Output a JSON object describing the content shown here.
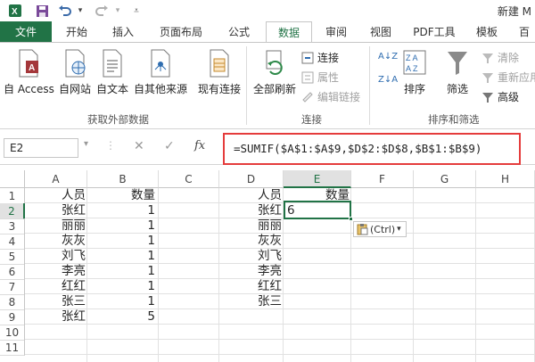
{
  "titlebar": {
    "title": "新建 M"
  },
  "tabs": [
    "文件",
    "开始",
    "插入",
    "页面布局",
    "公式",
    "数据",
    "审阅",
    "视图",
    "PDF工具",
    "模板",
    "百"
  ],
  "ribbon": {
    "external": {
      "access": "自 Access",
      "web": "自网站",
      "text": "自文本",
      "other": "自其他来源",
      "existing": "现有连接",
      "group": "获取外部数据"
    },
    "connections": {
      "refresh": "全部刷新",
      "conn": "连接",
      "props": "属性",
      "edit": "编辑链接",
      "group": "连接"
    },
    "sort": {
      "sort": "排序",
      "filter": "筛选",
      "clear": "清除",
      "reapply": "重新应用",
      "advanced": "高级",
      "group": "排序和筛选"
    }
  },
  "formula_bar": {
    "cell_ref": "E2",
    "fx": "fx",
    "formula": "=SUMIF($A$1:$A$9,$D$2:$D$8,$B$1:$B$9)"
  },
  "sheet": {
    "columns": [
      "A",
      "B",
      "C",
      "D",
      "E",
      "F",
      "G",
      "H"
    ],
    "rows": [
      "1",
      "2",
      "3",
      "4",
      "5",
      "6",
      "7",
      "8",
      "9",
      "10",
      "11"
    ],
    "colA": [
      "人员",
      "张红",
      "丽丽",
      "灰灰",
      "刘飞",
      "李亮",
      "红红",
      "张三",
      "张红"
    ],
    "colB": [
      "数量",
      "1",
      "1",
      "1",
      "1",
      "1",
      "1",
      "1",
      "5"
    ],
    "colD": [
      "人员",
      "张红",
      "丽丽",
      "灰灰",
      "刘飞",
      "李亮",
      "红红",
      "张三"
    ],
    "e1": "数量",
    "e2": "6",
    "paste_options": "(Ctrl)"
  },
  "colors": {
    "accent": "#217346",
    "highlight": "#e53c3c"
  }
}
